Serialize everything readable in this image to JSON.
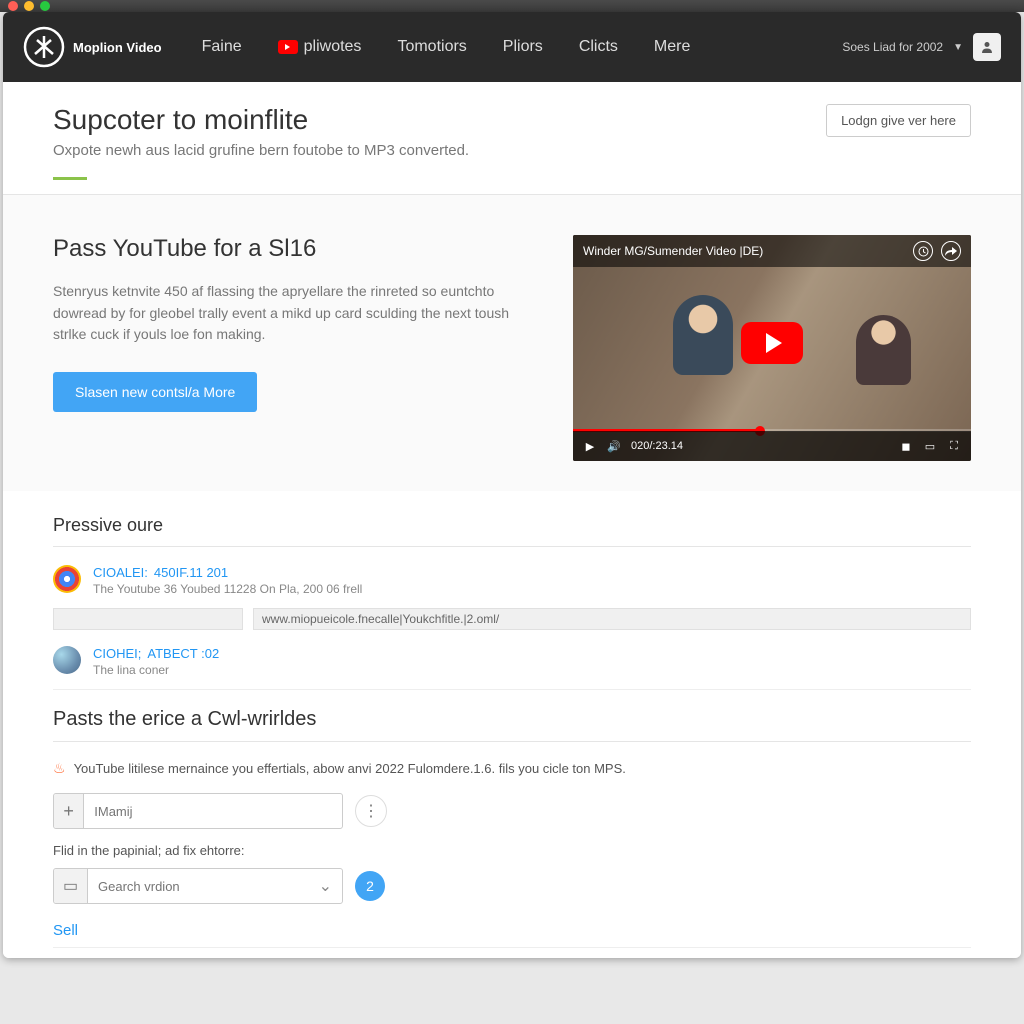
{
  "brand": {
    "name": "Moplion Video"
  },
  "nav": {
    "links": [
      "Faine",
      "pliwotes",
      "Tomotiors",
      "Pliors",
      "Clicts",
      "Mere"
    ],
    "status": "Soes Liad for  2002",
    "user_icon": "person-icon"
  },
  "hero": {
    "title": "Supcoter to moinflite",
    "subtitle": "Oxpote newh aus lacid grufine bern foutobe to MP3 converted.",
    "login_btn": "Lodgn give ver here"
  },
  "feature": {
    "heading": "Pass YouTube for a Sl16",
    "body": "Stenryus ketnvite 450 af flassing the apryellare the rinreted so euntchto dowread by for gleobel trally event a mikd up card sculding the next toush strlke cuck if youls loe fon making.",
    "cta": "Slasen new contsl/a More"
  },
  "player": {
    "title": "Winder MG/Sumender Video |DE)",
    "time": "020/:23.14"
  },
  "list": {
    "heading": "Pressive oure",
    "items": [
      {
        "title": "CIOALEI:",
        "num": "450IF.11 201",
        "sub": "The Youtube 36 Youbed 11228 On Pla, 200 06 frell"
      },
      {
        "title": "CIOHEI;",
        "num": "ATBECT :02",
        "sub": "The lina coner"
      }
    ],
    "url": "www.miopueicole.fnecalle|Youkchfitle.|2.oml/"
  },
  "form": {
    "heading": "Pasts the erice a Cwl-wrirldes",
    "note": "YouTube litilese mernaince you effertials, abow anvi 2022 Fulomdere.1.6. fils you cicle ton MPS.",
    "input_placeholder": "IMamij",
    "help": "Flid in the papinial; ad fix ehtorre:",
    "select_placeholder": "Gearch vrdion",
    "count": "2",
    "sell": "Sell"
  }
}
